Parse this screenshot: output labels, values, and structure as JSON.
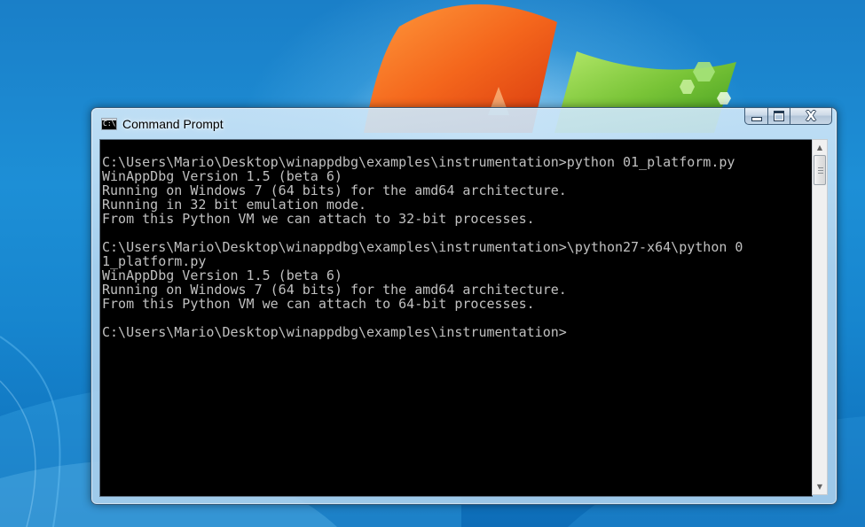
{
  "window": {
    "title": "Command Prompt",
    "icon_text": "C:\\_",
    "icon": "console-icon",
    "buttons": {
      "minimize": "minimize-icon",
      "maximize": "maximize-icon",
      "close": "close-icon",
      "close_glyph": "X"
    }
  },
  "console": {
    "lines": [
      "C:\\Users\\Mario\\Desktop\\winappdbg\\examples\\instrumentation>python 01_platform.py",
      "WinAppDbg Version 1.5 (beta 6)",
      "Running on Windows 7 (64 bits) for the amd64 architecture.",
      "Running in 32 bit emulation mode.",
      "From this Python VM we can attach to 32-bit processes.",
      "",
      "C:\\Users\\Mario\\Desktop\\winappdbg\\examples\\instrumentation>\\python27-x64\\python 0",
      "1_platform.py",
      "WinAppDbg Version 1.5 (beta 6)",
      "Running on Windows 7 (64 bits) for the amd64 architecture.",
      "From this Python VM we can attach to 64-bit processes.",
      "",
      "C:\\Users\\Mario\\Desktop\\winappdbg\\examples\\instrumentation>"
    ],
    "text_color": "#c0c0c0",
    "background": "#000000"
  },
  "scrollbar": {
    "up_arrow": "scroll-up-arrow-icon",
    "down_arrow": "scroll-down-arrow-icon",
    "up_glyph": "▲",
    "down_glyph": "▼"
  },
  "desktop": {
    "wallpaper": "windows-7-logo-wallpaper",
    "background_color": "#1d8fd6"
  }
}
